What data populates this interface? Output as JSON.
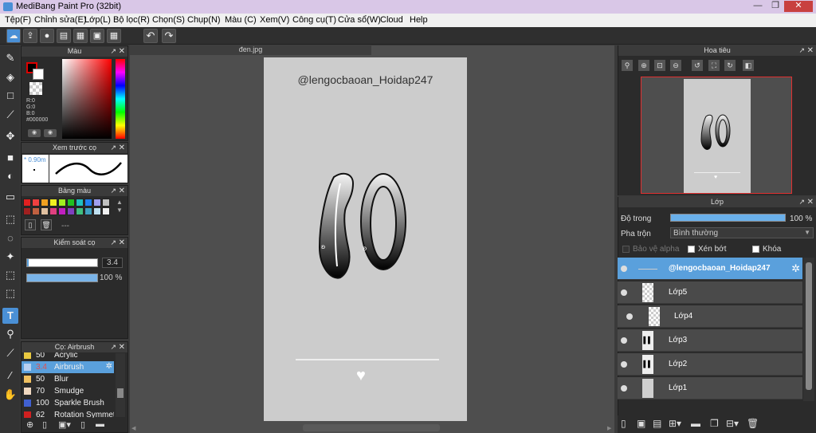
{
  "window": {
    "title": "MediBang Paint Pro (32bit)",
    "min": "—",
    "max": "❐",
    "close": "✕"
  },
  "menu": [
    "Tệp(F)",
    "Chỉnh sửa(E)",
    "Lớp(L)",
    "Bộ lọc(R)",
    "Chọn(S)",
    "Chụp(N)",
    "Màu (C)",
    "Xem(V)",
    "Công cụ(T)",
    "Cửa sổ(W)",
    "Cloud",
    "Help"
  ],
  "color_panel": {
    "title": "Màu",
    "r": "R:0",
    "g": "G:0",
    "b": "B:0",
    "hex": "#000000"
  },
  "brush_preview": {
    "title": "Xem trước cọ",
    "size": "* 0.90m"
  },
  "palette": {
    "title": "Bảng màu",
    "more": "---",
    "colors": [
      "#e02020",
      "#f04040",
      "#f0a020",
      "#f0f020",
      "#a0f020",
      "#20c020",
      "#20c0c0",
      "#2080f0",
      "#a0a0f0",
      "#c0c0c0",
      "#a02020",
      "#c06040",
      "#e0c0a0",
      "#e04080",
      "#c020c0",
      "#8040c0",
      "#40c080",
      "#40a0c0",
      "#c0e0f0",
      "#f0f0f0"
    ]
  },
  "brush_control": {
    "title": "Kiểm soát cọ",
    "size": "3.4",
    "opacity": "100 %",
    "size_fill": 0.02,
    "opacity_fill": 1.0
  },
  "brushes": {
    "title": "Cọ: Airbrush",
    "items": [
      {
        "num": "50",
        "name": "Acrylic",
        "color": "#e8c840"
      },
      {
        "num": "3.4",
        "name": "Airbrush",
        "color": "#b8d0f0",
        "selected": true
      },
      {
        "num": "50",
        "name": "Blur",
        "color": "#f0c060"
      },
      {
        "num": "70",
        "name": "Smudge",
        "color": "#f0d8c0"
      },
      {
        "num": "100",
        "name": "Sparkle Brush",
        "color": "#4060d0"
      },
      {
        "num": "62",
        "name": "Rotation Symmetry",
        "color": "#d02020"
      }
    ]
  },
  "document": {
    "tab": "đen.jpg",
    "watermark": "@lengocbaoan_Hoidap247"
  },
  "navigator": {
    "title": "Hoa tiêu"
  },
  "layers": {
    "title": "Lớp",
    "opacity_label": "Độ trong",
    "opacity_value": "100 %",
    "blend_label": "Pha trộn",
    "blend_value": "Bình thường",
    "protect_alpha": "Bảo vệ alpha",
    "clip": "Xén bớt",
    "lock": "Khóa",
    "items": [
      {
        "name": "@lengocbaoan_Hoidap247",
        "active": true
      },
      {
        "name": "Lớp5"
      },
      {
        "name": "Lớp4"
      },
      {
        "name": "Lớp3"
      },
      {
        "name": "Lớp2"
      },
      {
        "name": "Lớp1"
      }
    ]
  }
}
